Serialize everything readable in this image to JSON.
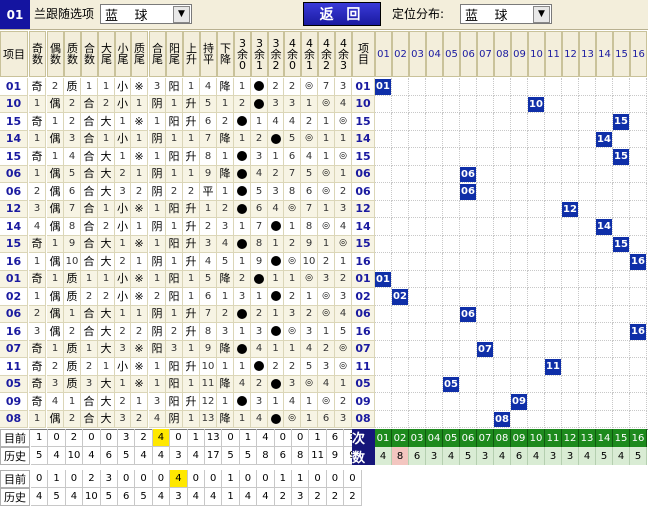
{
  "header": {
    "current_ball": "01",
    "follow_label": "兰跟随选项",
    "follow_value": "蓝    球",
    "back_label": "返  回",
    "position_label": "定位分布:",
    "position_value": "蓝    球"
  },
  "columns": [
    "项目",
    "奇数",
    "偶数",
    "质数",
    "合数",
    "大尾",
    "小尾",
    "质尾",
    "合尾",
    "阳尾",
    "上升",
    "持平",
    "下降",
    "3余0",
    "3余1",
    "3余2",
    "4余0",
    "4余1",
    "4余2",
    "4余3",
    "项目"
  ],
  "ball_columns": [
    "01",
    "02",
    "03",
    "04",
    "05",
    "06",
    "07",
    "08",
    "09",
    "10",
    "11",
    "12",
    "13",
    "14",
    "15",
    "16"
  ],
  "rows": [
    {
      "issue": "01",
      "vals": [
        "奇",
        "2",
        "质",
        "1",
        "1",
        "小",
        "※",
        "3",
        "阳",
        "1",
        "4",
        "降",
        "1",
        "●",
        "2",
        "2",
        "◎",
        "7",
        "3"
      ]
    },
    {
      "issue": "10",
      "vals": [
        "1",
        "偶",
        "2",
        "合",
        "2",
        "小",
        "1",
        "阴",
        "1",
        "升",
        "5",
        "1",
        "2",
        "●",
        "3",
        "3",
        "1",
        "◎",
        "4"
      ]
    },
    {
      "issue": "15",
      "vals": [
        "奇",
        "1",
        "2",
        "合",
        "大",
        "1",
        "※",
        "1",
        "阳",
        "升",
        "6",
        "2",
        "●",
        "1",
        "4",
        "4",
        "2",
        "1",
        "◎"
      ]
    },
    {
      "issue": "14",
      "vals": [
        "1",
        "偶",
        "3",
        "合",
        "1",
        "小",
        "1",
        "阴",
        "1",
        "1",
        "7",
        "降",
        "1",
        "2",
        "●",
        "5",
        "◎",
        "1",
        "1"
      ]
    },
    {
      "issue": "15",
      "vals": [
        "奇",
        "1",
        "4",
        "合",
        "大",
        "1",
        "※",
        "1",
        "阳",
        "升",
        "8",
        "1",
        "●",
        "3",
        "1",
        "6",
        "4",
        "1",
        "◎"
      ]
    },
    {
      "issue": "06",
      "vals": [
        "1",
        "偶",
        "5",
        "合",
        "大",
        "2",
        "1",
        "阴",
        "1",
        "1",
        "9",
        "降",
        "●",
        "4",
        "2",
        "7",
        "5",
        "◎",
        "1"
      ]
    },
    {
      "issue": "06",
      "vals": [
        "2",
        "偶",
        "6",
        "合",
        "大",
        "3",
        "2",
        "阴",
        "2",
        "2",
        "平",
        "1",
        "●",
        "5",
        "3",
        "8",
        "6",
        "◎",
        "2"
      ]
    },
    {
      "issue": "12",
      "vals": [
        "3",
        "偶",
        "7",
        "合",
        "1",
        "小",
        "※",
        "1",
        "阳",
        "升",
        "1",
        "2",
        "●",
        "6",
        "4",
        "◎",
        "7",
        "1",
        "3"
      ]
    },
    {
      "issue": "14",
      "vals": [
        "4",
        "偶",
        "8",
        "合",
        "2",
        "小",
        "1",
        "阴",
        "1",
        "升",
        "2",
        "3",
        "1",
        "7",
        "●",
        "1",
        "8",
        "◎",
        "4"
      ]
    },
    {
      "issue": "15",
      "vals": [
        "奇",
        "1",
        "9",
        "合",
        "大",
        "1",
        "※",
        "1",
        "阳",
        "升",
        "3",
        "4",
        "●",
        "8",
        "1",
        "2",
        "9",
        "1",
        "◎"
      ]
    },
    {
      "issue": "16",
      "vals": [
        "1",
        "偶",
        "10",
        "合",
        "大",
        "2",
        "1",
        "阴",
        "1",
        "升",
        "4",
        "5",
        "1",
        "9",
        "●",
        "◎",
        "10",
        "2",
        "1"
      ]
    },
    {
      "issue": "01",
      "vals": [
        "奇",
        "1",
        "质",
        "1",
        "1",
        "小",
        "※",
        "1",
        "阳",
        "1",
        "5",
        "降",
        "2",
        "●",
        "1",
        "1",
        "◎",
        "3",
        "2"
      ]
    },
    {
      "issue": "02",
      "vals": [
        "1",
        "偶",
        "质",
        "2",
        "2",
        "小",
        "※",
        "2",
        "阳",
        "1",
        "6",
        "1",
        "3",
        "1",
        "●",
        "2",
        "1",
        "◎",
        "3"
      ]
    },
    {
      "issue": "06",
      "vals": [
        "2",
        "偶",
        "1",
        "合",
        "大",
        "1",
        "1",
        "阴",
        "1",
        "升",
        "7",
        "2",
        "●",
        "2",
        "1",
        "3",
        "2",
        "◎",
        "4"
      ]
    },
    {
      "issue": "16",
      "vals": [
        "3",
        "偶",
        "2",
        "合",
        "大",
        "2",
        "2",
        "阴",
        "2",
        "升",
        "8",
        "3",
        "1",
        "3",
        "●",
        "◎",
        "3",
        "1",
        "5"
      ]
    },
    {
      "issue": "07",
      "vals": [
        "奇",
        "1",
        "质",
        "1",
        "大",
        "3",
        "※",
        "阳",
        "3",
        "1",
        "9",
        "降",
        "●",
        "4",
        "1",
        "1",
        "4",
        "2",
        "◎"
      ]
    },
    {
      "issue": "11",
      "vals": [
        "奇",
        "2",
        "质",
        "2",
        "1",
        "小",
        "※",
        "1",
        "阳",
        "升",
        "10",
        "1",
        "1",
        "●",
        "2",
        "2",
        "5",
        "3",
        "◎"
      ]
    },
    {
      "issue": "05",
      "vals": [
        "奇",
        "3",
        "质",
        "3",
        "大",
        "1",
        "※",
        "1",
        "阳",
        "1",
        "11",
        "降",
        "4",
        "2",
        "●",
        "3",
        "◎",
        "4",
        "1"
      ]
    },
    {
      "issue": "09",
      "vals": [
        "奇",
        "4",
        "1",
        "合",
        "大",
        "2",
        "1",
        "3",
        "阳",
        "升",
        "12",
        "1",
        "●",
        "3",
        "1",
        "4",
        "1",
        "◎",
        "2"
      ]
    },
    {
      "issue": "08",
      "vals": [
        "1",
        "偶",
        "2",
        "合",
        "大",
        "3",
        "2",
        "4",
        "阴",
        "1",
        "13",
        "降",
        "1",
        "4",
        "●",
        "◎",
        "1",
        "6",
        "3"
      ]
    }
  ],
  "bottom": {
    "current_label": "目前",
    "history_label": "历史",
    "cishu_label": "次数",
    "current1": [
      "1",
      "0",
      "2",
      "0",
      "0",
      "3",
      "2",
      "4",
      "0",
      "1",
      "13",
      "0",
      "1",
      "4",
      "0",
      "0",
      "1",
      "6",
      "3"
    ],
    "history1": [
      "5",
      "4",
      "10",
      "4",
      "6",
      "5",
      "4",
      "4",
      "3",
      "4",
      "17",
      "5",
      "5",
      "8",
      "6",
      "8",
      "11",
      "9",
      "9"
    ],
    "ball_numbers": [
      "01",
      "02",
      "03",
      "04",
      "05",
      "06",
      "07",
      "08",
      "09",
      "10",
      "11",
      "12",
      "13",
      "14",
      "15",
      "16"
    ],
    "counts": [
      "4",
      "8",
      "6",
      "3",
      "4",
      "5",
      "3",
      "4",
      "6",
      "4",
      "3",
      "3",
      "4",
      "5",
      "4",
      "5"
    ],
    "current2": [
      "0",
      "1",
      "0",
      "2",
      "3",
      "0",
      "0",
      "0",
      "4",
      "0",
      "0",
      "1",
      "0",
      "0",
      "1",
      "1",
      "0",
      "0",
      "0"
    ],
    "history2": [
      "4",
      "5",
      "4",
      "10",
      "5",
      "6",
      "5",
      "4",
      "3",
      "4",
      "4",
      "1",
      "4",
      "4",
      "2",
      "3",
      "2",
      "2",
      "2"
    ]
  },
  "colors": {
    "accent": "#1414a0",
    "hit_block": "#0f2fa8",
    "count_header": "#1d8a1d",
    "highlight": "#ffe800"
  }
}
